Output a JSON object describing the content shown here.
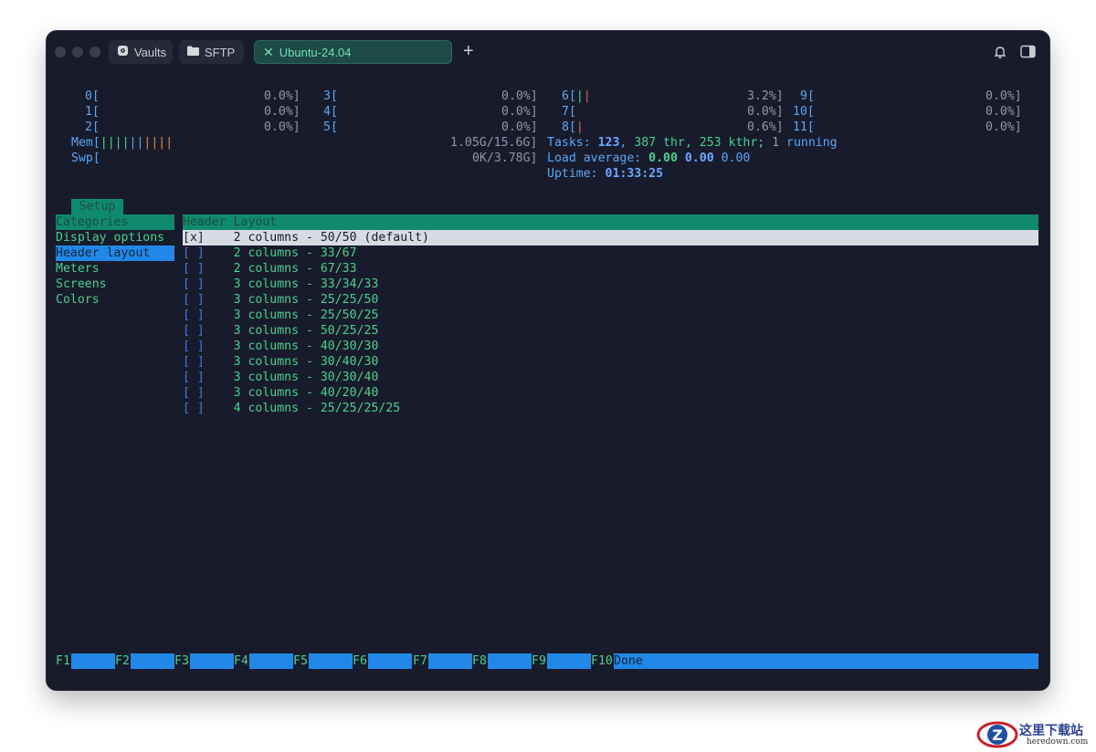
{
  "window": {
    "tabs": [
      {
        "label": "Vaults",
        "icon": "vault-icon",
        "active": false
      },
      {
        "label": "SFTP",
        "icon": "folder-icon",
        "active": false
      },
      {
        "label": "Ubuntu-24.04",
        "icon": "close-icon",
        "active": true
      }
    ],
    "new_tab_symbol": "+",
    "right_icons": [
      "bell-icon",
      "sidebar-toggle-icon"
    ]
  },
  "htop": {
    "cpus": [
      {
        "id": "0",
        "label": "0[",
        "value": "0.0%]"
      },
      {
        "id": "1",
        "label": "1[",
        "value": "0.0%]"
      },
      {
        "id": "2",
        "label": "2[",
        "value": "0.0%]"
      },
      {
        "id": "3",
        "label": "3[",
        "value": "0.0%]"
      },
      {
        "id": "4",
        "label": "4[",
        "value": "0.0%]"
      },
      {
        "id": "5",
        "label": "5[",
        "value": "0.0%]"
      },
      {
        "id": "6",
        "label": "6[",
        "value": "3.2%]",
        "bars": "||"
      },
      {
        "id": "7",
        "label": "7[",
        "value": "0.0%]"
      },
      {
        "id": "8",
        "label": "8[",
        "value": "0.6%]",
        "bars": "|"
      },
      {
        "id": "9",
        "label": "9[",
        "value": "0.0%]"
      },
      {
        "id": "10",
        "label": "10[",
        "value": "0.0%]"
      },
      {
        "id": "11",
        "label": "11[",
        "value": "0.0%]"
      }
    ],
    "mem": {
      "label": "Mem[",
      "bars": "||||||||||",
      "value": "1.05G/15.6G]"
    },
    "swp": {
      "label": "Swp[",
      "value": "0K/3.78G]"
    },
    "tasks": {
      "label": "Tasks: ",
      "count": "123",
      "thr_sep": ", ",
      "thr": "387 thr, 253 kthr;",
      "running_n": " 1",
      "running": " running"
    },
    "load": {
      "label": "Load average: ",
      "v1": "0.00",
      "v2": "0.00",
      "v3": "0.00"
    },
    "uptime": {
      "label": "Uptime: ",
      "value": "01:33:25"
    }
  },
  "setup": {
    "tab_label": "Setup",
    "categories_header": "Categories",
    "categories": [
      "Display options",
      "Header layout",
      "Meters",
      "Screens",
      "Colors"
    ],
    "selected_category": "Header layout",
    "panel_header": "Header Layout",
    "options": [
      {
        "check": "[x]",
        "label": "2 columns - 50/50 (default)",
        "selected": true
      },
      {
        "check": "[ ]",
        "label": "2 columns - 33/67"
      },
      {
        "check": "[ ]",
        "label": "2 columns - 67/33"
      },
      {
        "check": "[ ]",
        "label": "3 columns - 33/34/33"
      },
      {
        "check": "[ ]",
        "label": "3 columns - 25/25/50"
      },
      {
        "check": "[ ]",
        "label": "3 columns - 25/50/25"
      },
      {
        "check": "[ ]",
        "label": "3 columns - 50/25/25"
      },
      {
        "check": "[ ]",
        "label": "3 columns - 40/30/30"
      },
      {
        "check": "[ ]",
        "label": "3 columns - 30/40/30"
      },
      {
        "check": "[ ]",
        "label": "3 columns - 30/30/40"
      },
      {
        "check": "[ ]",
        "label": "3 columns - 40/20/40"
      },
      {
        "check": "[ ]",
        "label": "4 columns - 25/25/25/25"
      }
    ]
  },
  "function_keys": [
    {
      "key": "F1",
      "label": ""
    },
    {
      "key": "F2",
      "label": ""
    },
    {
      "key": "F3",
      "label": ""
    },
    {
      "key": "F4",
      "label": ""
    },
    {
      "key": "F5",
      "label": ""
    },
    {
      "key": "F6",
      "label": ""
    },
    {
      "key": "F7",
      "label": ""
    },
    {
      "key": "F8",
      "label": ""
    },
    {
      "key": "F9",
      "label": ""
    },
    {
      "key": "F10",
      "label": "Done"
    }
  ],
  "watermark": {
    "title": "这里下载站",
    "url": "heredown.com"
  },
  "colors": {
    "background": "#181b2c",
    "accent": "#0f8a6c",
    "highlight": "#2188e8",
    "text_green": "#4bd08a"
  }
}
